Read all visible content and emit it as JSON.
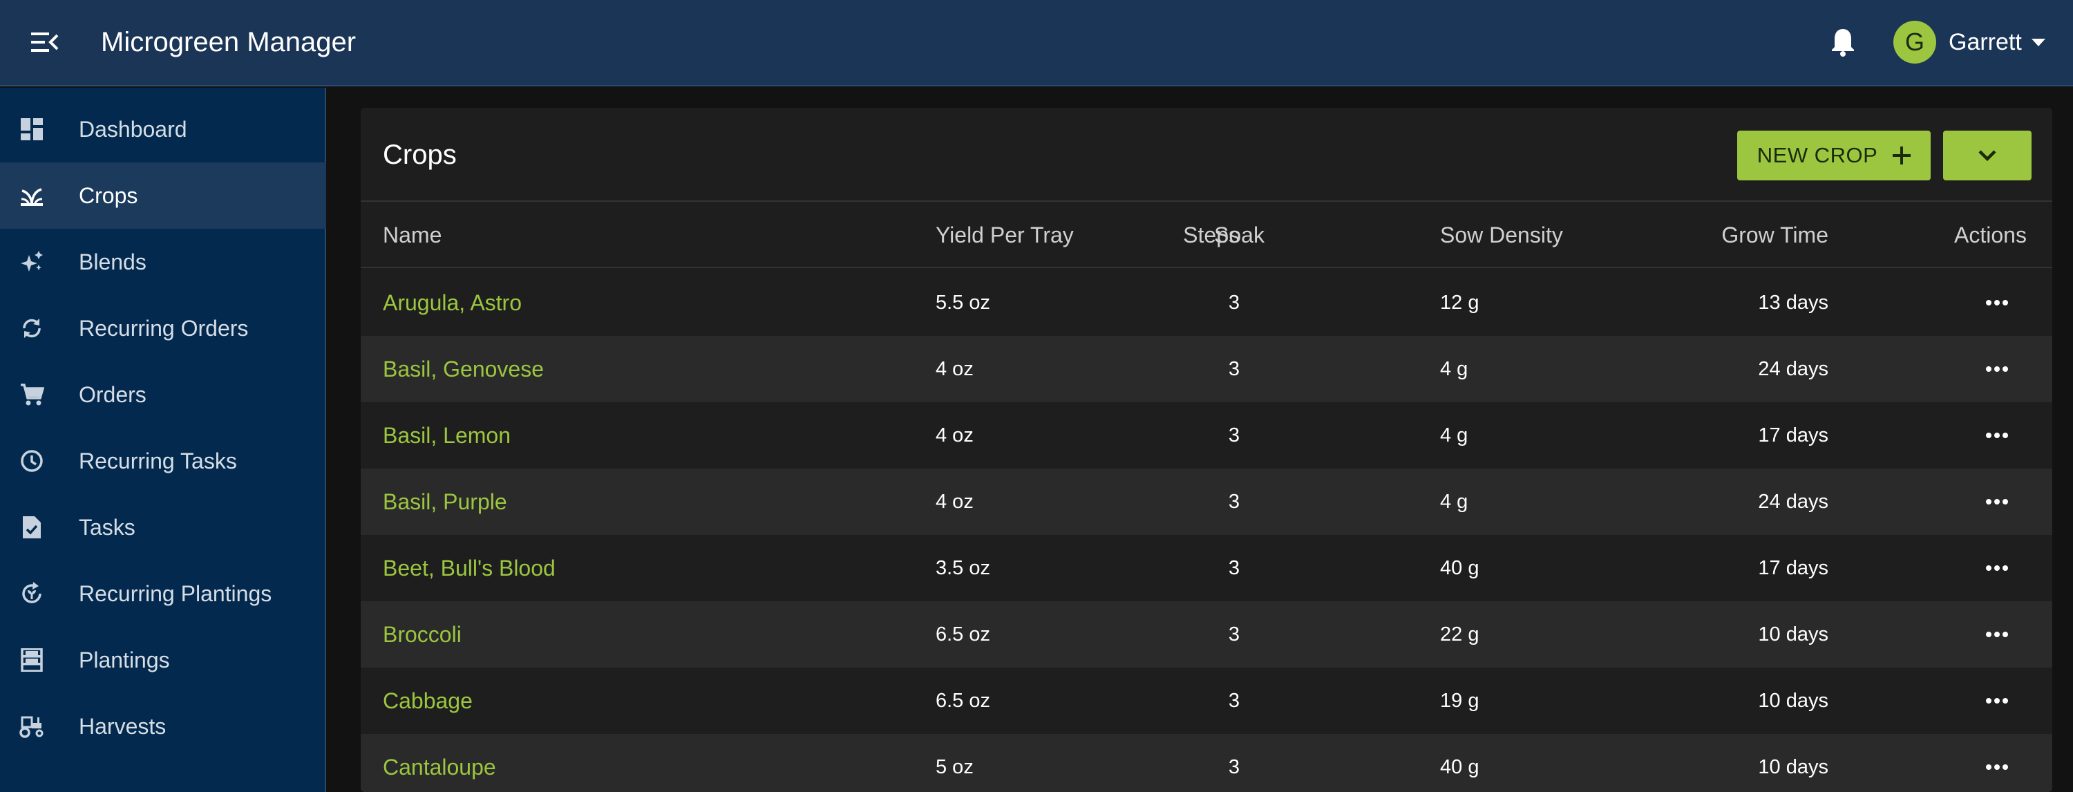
{
  "app": {
    "title": "Microgreen Manager",
    "accent_color": "#9cc63f",
    "topbar_color": "#1b3557",
    "sidebar_color": "#032a4e"
  },
  "user": {
    "initial": "G",
    "name": "Garrett"
  },
  "sidebar": {
    "items": [
      {
        "label": "Dashboard",
        "icon": "dashboard-icon",
        "active": false
      },
      {
        "label": "Crops",
        "icon": "sprout-icon",
        "active": true
      },
      {
        "label": "Blends",
        "icon": "sparkles-icon",
        "active": false
      },
      {
        "label": "Recurring Orders",
        "icon": "autorenew-icon",
        "active": false
      },
      {
        "label": "Orders",
        "icon": "cart-icon",
        "active": false
      },
      {
        "label": "Recurring Tasks",
        "icon": "clock-icon",
        "active": false
      },
      {
        "label": "Tasks",
        "icon": "task-icon",
        "active": false
      },
      {
        "label": "Recurring Plantings",
        "icon": "rotate-plant-icon",
        "active": false
      },
      {
        "label": "Plantings",
        "icon": "shelves-icon",
        "active": false
      },
      {
        "label": "Harvests",
        "icon": "tractor-icon",
        "active": false
      }
    ]
  },
  "page": {
    "title": "Crops",
    "new_button_label": "NEW CROP"
  },
  "table": {
    "columns": {
      "name": "Name",
      "steps": "Steps",
      "yield": "Yield Per Tray",
      "soak": "Soak",
      "density": "Sow Density",
      "grow": "Grow Time",
      "actions": "Actions"
    },
    "rows": [
      {
        "name": "Arugula, Astro",
        "steps": "3",
        "yield": "5.5 oz",
        "soak": "",
        "density": "12 g",
        "grow": "13 days"
      },
      {
        "name": "Basil, Genovese",
        "steps": "3",
        "yield": "4 oz",
        "soak": "",
        "density": "4 g",
        "grow": "24 days"
      },
      {
        "name": "Basil, Lemon",
        "steps": "3",
        "yield": "4 oz",
        "soak": "",
        "density": "4 g",
        "grow": "17 days"
      },
      {
        "name": "Basil, Purple",
        "steps": "3",
        "yield": "4 oz",
        "soak": "",
        "density": "4 g",
        "grow": "24 days"
      },
      {
        "name": "Beet, Bull's Blood",
        "steps": "3",
        "yield": "3.5 oz",
        "soak": "",
        "density": "40 g",
        "grow": "17 days"
      },
      {
        "name": "Broccoli",
        "steps": "3",
        "yield": "6.5 oz",
        "soak": "",
        "density": "22 g",
        "grow": "10 days"
      },
      {
        "name": "Cabbage",
        "steps": "3",
        "yield": "6.5 oz",
        "soak": "",
        "density": "19 g",
        "grow": "10 days"
      },
      {
        "name": "Cantaloupe",
        "steps": "3",
        "yield": "5 oz",
        "soak": "",
        "density": "40 g",
        "grow": "10 days"
      }
    ]
  }
}
